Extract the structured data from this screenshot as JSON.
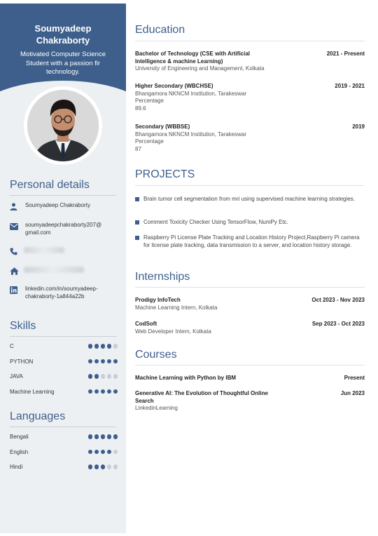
{
  "profile": {
    "name_line1": "Soumyadeep",
    "name_line2": "Chakraborty",
    "tagline": "Motivated Computer Science Student with a passion fir technology."
  },
  "personal": {
    "title": "Personal details",
    "name": "Soumyadeep Chakraborty",
    "email_line1": "soumyadeepchakraborty207@",
    "email_line2": "gmail.com",
    "phone_visible": "",
    "address_visible": "",
    "linkedin_line1": "linkedin.com/in/soumyadeep-",
    "linkedin_line2": "chakraborty-1a844a22b"
  },
  "skills": {
    "title": "Skills",
    "items": [
      {
        "label": "C",
        "level": 4
      },
      {
        "label": "PYTHON",
        "level": 5
      },
      {
        "label": "JAVA",
        "level": 2
      },
      {
        "label": "Machine Learning",
        "level": 5
      }
    ]
  },
  "languages": {
    "title": "Languages",
    "items": [
      {
        "label": "Bengali",
        "level": 5
      },
      {
        "label": "English",
        "level": 4
      },
      {
        "label": "Hindi",
        "level": 3
      }
    ]
  },
  "education": {
    "title": "Education",
    "items": [
      {
        "title": "Bachelor of Technology (CSE with Artificial Intelligence & machine Learning)",
        "date": "2021 - Present",
        "sub1": "University of Engineering and Management, Kolkata"
      },
      {
        "title": "Higher Secondary (WBCHSE)",
        "date": "2019 - 2021",
        "sub1": "Bhangamora NKNCM Institution, Tarakeswar",
        "sub2": "Percentage",
        "sub3": "89.6"
      },
      {
        "title": "Secondary (WBBSE)",
        "date": "2019",
        "sub1": "Bhangamora NKNCM Institution, Tarakeswar",
        "sub2": "Percentage",
        "sub3": "87"
      }
    ]
  },
  "projects": {
    "title": "PROJECTS",
    "items": [
      "Brain tumor cell  segmentation from mri using supervised machine learning strategies.",
      "Comment Toxicity Checker Using TensorFlow, NumPy Etc.",
      "Raspberry Pi License Plate Tracking and Location History Project,Raspberry Pi camera for license plate tracking, data transmission to a server, and location history storage."
    ]
  },
  "internships": {
    "title": "Internships",
    "items": [
      {
        "title": "Prodigy InfoTech",
        "date": "Oct 2023 - Nov 2023",
        "sub1": "Machine Learning Intern, Kolkata"
      },
      {
        "title": "CodSoft",
        "date": "Sep 2023 - Oct 2023",
        "sub1": "Web Developer Intern, Kolkata"
      }
    ]
  },
  "courses": {
    "title": "Courses",
    "items": [
      {
        "title": "Machine Learning with Python by IBM",
        "date": "Present",
        "sub1": ""
      },
      {
        "title": "Generative AI: The Evolution of Thoughtful Online Search",
        "date": "Jun 2023",
        "sub1": "LinkedinLearning"
      }
    ]
  },
  "colors": {
    "accent": "#3e5f8c",
    "sidebar_bg": "#edf0f3"
  },
  "icons": {
    "person": "person-icon",
    "email": "email-icon",
    "phone": "phone-icon",
    "home": "home-icon",
    "linkedin": "linkedin-icon"
  }
}
